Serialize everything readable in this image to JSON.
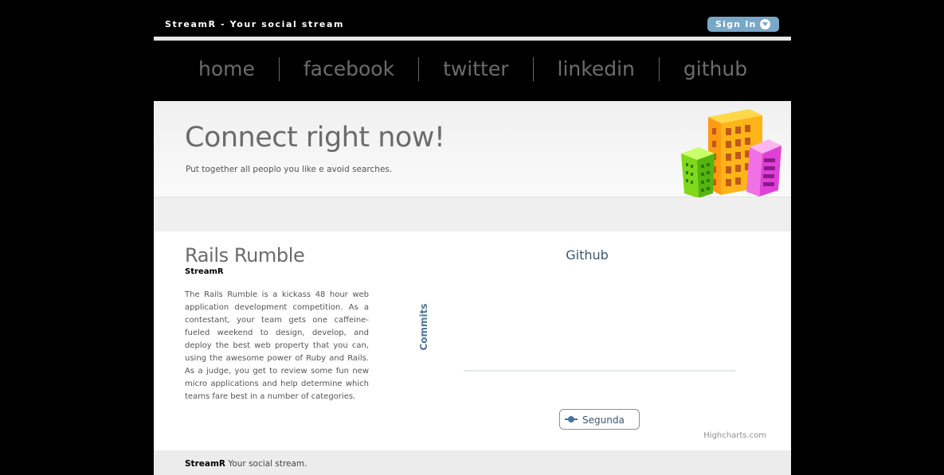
{
  "header": {
    "brand": "StreamR - Your social stream",
    "signin_label": "Sign In"
  },
  "nav": {
    "items": [
      {
        "label": "home"
      },
      {
        "label": "facebook"
      },
      {
        "label": "twitter"
      },
      {
        "label": "linkedin"
      },
      {
        "label": "github"
      }
    ]
  },
  "hero": {
    "title": "Connect right now!",
    "subtitle": "Put together all peoplo you like e avoid searches."
  },
  "article": {
    "title": "Rails Rumble",
    "subtitle": "StreamR",
    "body": "The Rails Rumble is a kickass 48 hour web application development competition. As a contestant, your team gets one caffeine-fueled weekend to design, develop, and deploy the best web property that you can, using the awesome power of Ruby and Rails. As a judge, you get to review some fun new micro applications and help determine which teams fare best in a number of categories."
  },
  "chart_data": {
    "type": "line",
    "title": "Github",
    "ylabel": "Commits",
    "xlabel": "",
    "series": [
      {
        "name": "Segunda",
        "values": []
      }
    ],
    "legend": "bottom-center",
    "credits": "Highcharts.com",
    "colors": {
      "series": "#4572a7",
      "title": "#3e576f"
    }
  },
  "footer": {
    "brand": "StreamR",
    "tagline": " Your social stream."
  }
}
